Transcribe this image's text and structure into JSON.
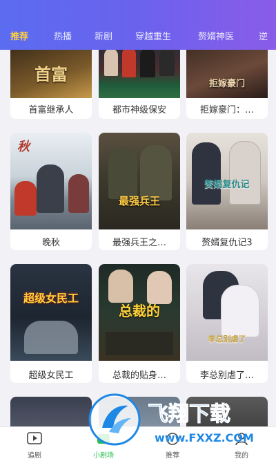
{
  "tabs": [
    "推荐",
    "热播",
    "新剧",
    "穿越重生",
    "赘婿神医",
    "逆"
  ],
  "active_tab": 0,
  "dramas": [
    {
      "title": "首富继承人",
      "poster_text": "首富"
    },
    {
      "title": "都市神级保安",
      "poster_text": ""
    },
    {
      "title": "拒嫁豪门：…",
      "poster_text": "拒嫁豪门"
    },
    {
      "title": "晚秋",
      "poster_text": "秋"
    },
    {
      "title": "最强兵王之…",
      "poster_text": "最强兵王"
    },
    {
      "title": "赘婿复仇记3",
      "poster_text": "赘婿复仇记"
    },
    {
      "title": "超级女民工",
      "poster_text": "超级女民工"
    },
    {
      "title": "总裁的贴身…",
      "poster_text": "总裁的"
    },
    {
      "title": "李总别虐了…",
      "poster_text": "李总别虐了"
    }
  ],
  "bottom_nav": [
    {
      "label": "追剧",
      "icon": "play-box-icon"
    },
    {
      "label": "小剧场",
      "icon": "theater-icon"
    },
    {
      "label": "推荐",
      "icon": "recommend-icon"
    },
    {
      "label": "我的",
      "icon": "user-icon"
    }
  ],
  "active_nav": 1,
  "watermark": {
    "brand": "飞翔下载",
    "url": "www.FXXZ.COM"
  },
  "colors": {
    "accent": "#ffd13b",
    "nav_active": "#2bbf4f",
    "header": "#6a62ee"
  }
}
